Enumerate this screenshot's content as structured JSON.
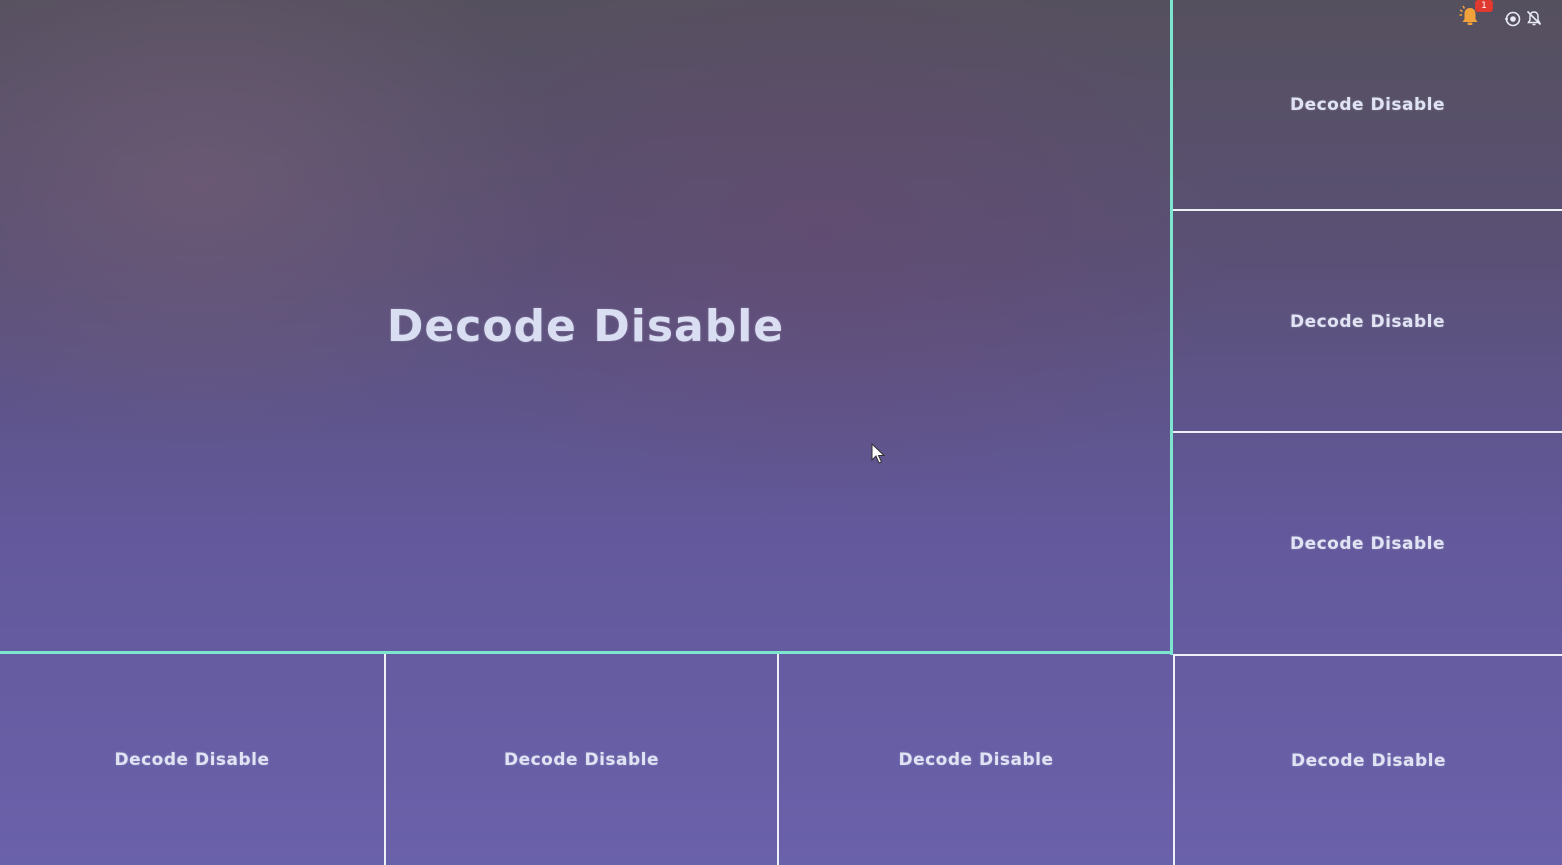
{
  "status_bar": {
    "alarm_count": "1",
    "icons": [
      "alarm-bell-icon",
      "recording-icon",
      "mute-bell-icon"
    ]
  },
  "tiles": {
    "main": "Decode Disable",
    "right_1": "Decode Disable",
    "right_2": "Decode Disable",
    "right_3": "Decode Disable",
    "right_4": "Decode Disable",
    "bottom_1": "Decode Disable",
    "bottom_2": "Decode Disable",
    "bottom_3": "Decode Disable"
  },
  "colors": {
    "selected_border": "#7de6cf",
    "grid_line": "#eef0f6",
    "alarm_badge": "#e0392f",
    "alarm_bell": "#f2a23a"
  }
}
